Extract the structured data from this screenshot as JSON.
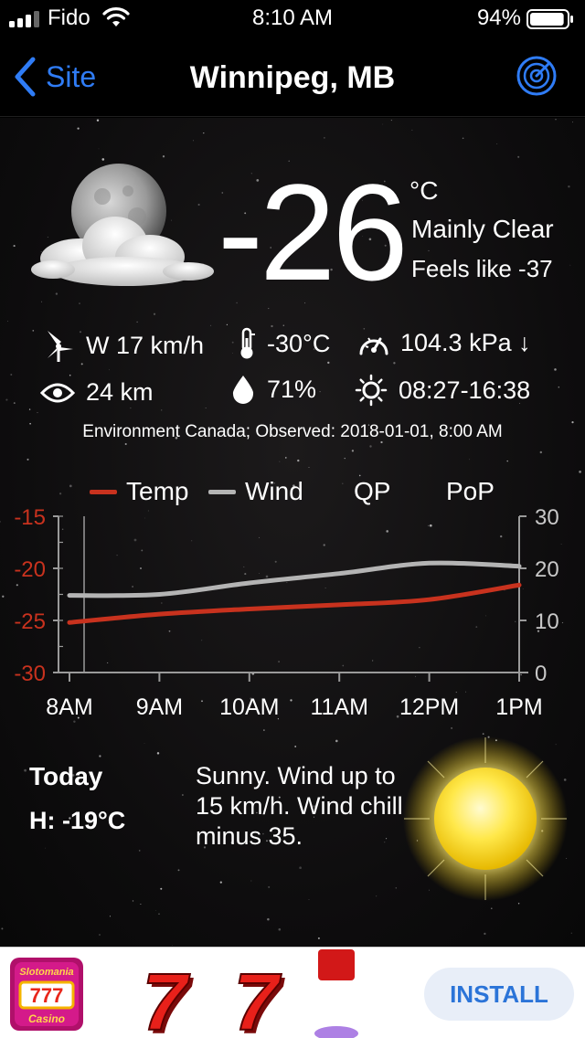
{
  "status_bar": {
    "carrier": "Fido",
    "time": "8:10 AM",
    "battery": "94%",
    "battery_level": 0.94
  },
  "nav": {
    "back_label": "Site",
    "title": "Winnipeg, MB",
    "radar_icon": "radar-icon"
  },
  "current": {
    "temperature": "-26",
    "unit": "°C",
    "condition": "Mainly Clear",
    "feels_like": "Feels like -37",
    "icon": "moon-cloud-icon"
  },
  "details": {
    "wind": "W 17 km/h",
    "dewpoint": "-30°C",
    "pressure": "104.3 kPa ↓",
    "visibility": "24 km",
    "humidity": "71%",
    "daylight": "08:27-16:38"
  },
  "source": "Environment Canada; Observed: 2018-01-01, 8:00 AM",
  "colors": {
    "temp_line": "#c8321e",
    "wind_line": "#b4b4b4",
    "accent_blue": "#2f7cf6"
  },
  "chart_data": {
    "type": "line",
    "legend": [
      "Temp",
      "Wind",
      "QP",
      "PoP"
    ],
    "x": [
      "8AM",
      "9AM",
      "10AM",
      "11AM",
      "12PM",
      "1PM"
    ],
    "series": [
      {
        "name": "Temp",
        "axis": "left",
        "values": [
          -25.2,
          -24.4,
          -23.9,
          -23.5,
          -23.0,
          -21.6
        ]
      },
      {
        "name": "Wind",
        "axis": "right",
        "values": [
          14.8,
          15.0,
          17.2,
          19.0,
          21.0,
          20.4
        ]
      }
    ],
    "y_left": {
      "ticks": [
        "-15",
        "-20",
        "-25",
        "-30"
      ],
      "range": [
        -30,
        -15
      ]
    },
    "y_right": {
      "ticks": [
        "30",
        "20",
        "10",
        "0"
      ],
      "range": [
        0,
        30
      ]
    }
  },
  "forecast": {
    "day": "Today",
    "high": "H: -19°C",
    "text": "Sunny. Wind up to 15 km/h. Wind chill minus 35.",
    "icon": "sun-icon"
  },
  "ad": {
    "logo_line1": "Slotomania",
    "logo_line2": "Casino",
    "install": "INSTALL"
  }
}
